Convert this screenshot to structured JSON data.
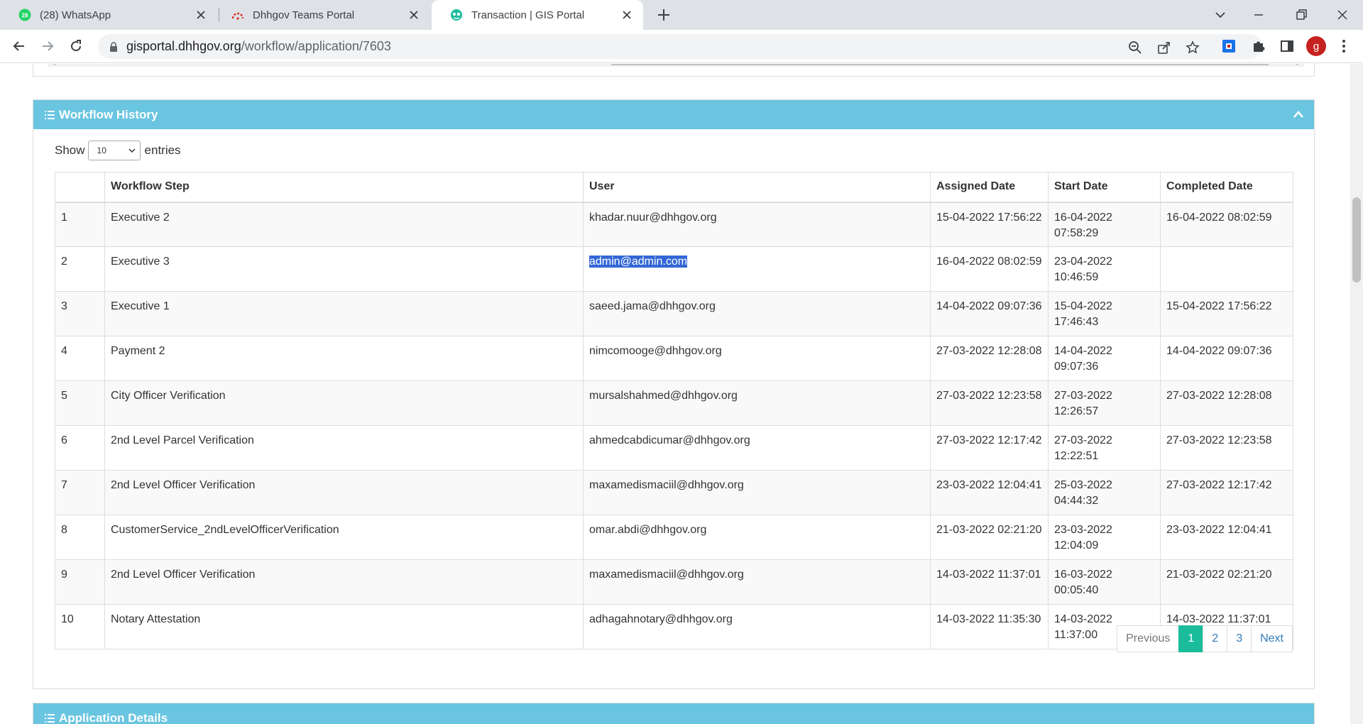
{
  "browser": {
    "tabs": [
      {
        "title": "(28) WhatsApp",
        "badge": "28"
      },
      {
        "title": "Dhhgov Teams Portal"
      },
      {
        "title": "Transaction | GIS Portal"
      }
    ],
    "url_host": "gisportal.dhhgov.org",
    "url_path": "/workflow/application/7603",
    "avatar_letter": "g"
  },
  "workflow": {
    "title": "Workflow History",
    "show_label": "Show",
    "entries_label": "entries",
    "page_size": "10",
    "columns": [
      "",
      "Workflow Step",
      "User",
      "Assigned Date",
      "Start Date",
      "Completed Date"
    ],
    "rows": [
      {
        "no": "1",
        "step": "Executive 2",
        "user": "khadar.nuur@dhhgov.org",
        "assigned": "15-04-2022 17:56:22",
        "start": "16-04-2022 07:58:29",
        "completed": "16-04-2022 08:02:59"
      },
      {
        "no": "2",
        "step": "Executive 3",
        "user": "admin@admin.com",
        "assigned": "16-04-2022 08:02:59",
        "start": "23-04-2022 10:46:59",
        "completed": ""
      },
      {
        "no": "3",
        "step": "Executive 1",
        "user": "saeed.jama@dhhgov.org",
        "assigned": "14-04-2022 09:07:36",
        "start": "15-04-2022 17:46:43",
        "completed": "15-04-2022 17:56:22"
      },
      {
        "no": "4",
        "step": "Payment 2",
        "user": "nimcomooge@dhhgov.org",
        "assigned": "27-03-2022 12:28:08",
        "start": "14-04-2022 09:07:36",
        "completed": "14-04-2022 09:07:36"
      },
      {
        "no": "5",
        "step": "City Officer Verification",
        "user": "mursalshahmed@dhhgov.org",
        "assigned": "27-03-2022 12:23:58",
        "start": "27-03-2022 12:26:57",
        "completed": "27-03-2022 12:28:08"
      },
      {
        "no": "6",
        "step": "2nd Level Parcel Verification",
        "user": "ahmedcabdicumar@dhhgov.org",
        "assigned": "27-03-2022 12:17:42",
        "start": "27-03-2022 12:22:51",
        "completed": "27-03-2022 12:23:58"
      },
      {
        "no": "7",
        "step": "2nd Level Officer Verification",
        "user": "maxamedismaciil@dhhgov.org",
        "assigned": "23-03-2022 12:04:41",
        "start": "25-03-2022 04:44:32",
        "completed": "27-03-2022 12:17:42"
      },
      {
        "no": "8",
        "step": "CustomerService_2ndLevelOfficerVerification",
        "user": "omar.abdi@dhhgov.org",
        "assigned": "21-03-2022 02:21:20",
        "start": "23-03-2022 12:04:09",
        "completed": "23-03-2022 12:04:41"
      },
      {
        "no": "9",
        "step": "2nd Level Officer Verification",
        "user": "maxamedismaciil@dhhgov.org",
        "assigned": "14-03-2022 11:37:01",
        "start": "16-03-2022 00:05:40",
        "completed": "21-03-2022 02:21:20"
      },
      {
        "no": "10",
        "step": "Notary Attestation",
        "user": "adhagahnotary@dhhgov.org",
        "assigned": "14-03-2022 11:35:30",
        "start": "14-03-2022 11:37:00",
        "completed": "14-03-2022 11:37:01"
      }
    ],
    "pagination": {
      "previous": "Previous",
      "pages": [
        "1",
        "2",
        "3"
      ],
      "current": "1",
      "next": "Next"
    }
  },
  "application_details": {
    "title": "Application Details"
  },
  "colors": {
    "panel_header": "#6ac5e0",
    "active_page": "#1abc9c",
    "selection": "#3367d6",
    "link": "#337ab7"
  }
}
